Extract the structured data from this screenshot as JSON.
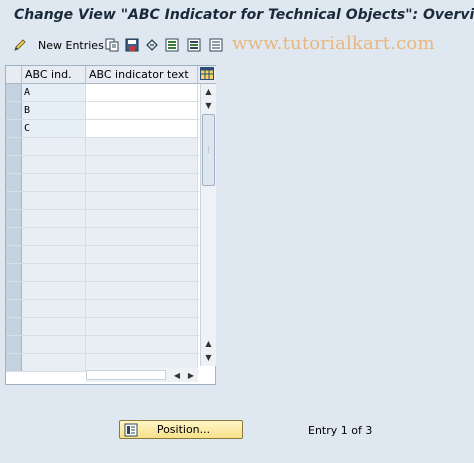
{
  "window": {
    "title": "Change View \"ABC Indicator for Technical Objects\": Overview"
  },
  "toolbar": {
    "new_entries_label": "New Entries",
    "icons": [
      "pen-icon",
      "copy-icon",
      "save-icon",
      "undo-icon",
      "select-all-icon",
      "select-block-icon",
      "deselect-icon"
    ]
  },
  "watermark": {
    "text": "www.tutorialkart.com"
  },
  "table": {
    "columns": [
      "ABC ind.",
      "ABC indicator text"
    ],
    "rows": [
      {
        "abc_ind": "A",
        "text": ""
      },
      {
        "abc_ind": "B",
        "text": ""
      },
      {
        "abc_ind": "C",
        "text": ""
      }
    ],
    "empty_rows": 13
  },
  "footer": {
    "position_label": "Position...",
    "entry_status": "Entry 1 of 3"
  },
  "colors": {
    "background": "#dfe8f1",
    "watermark": "#e8b77d",
    "button": "#f7e08a"
  }
}
